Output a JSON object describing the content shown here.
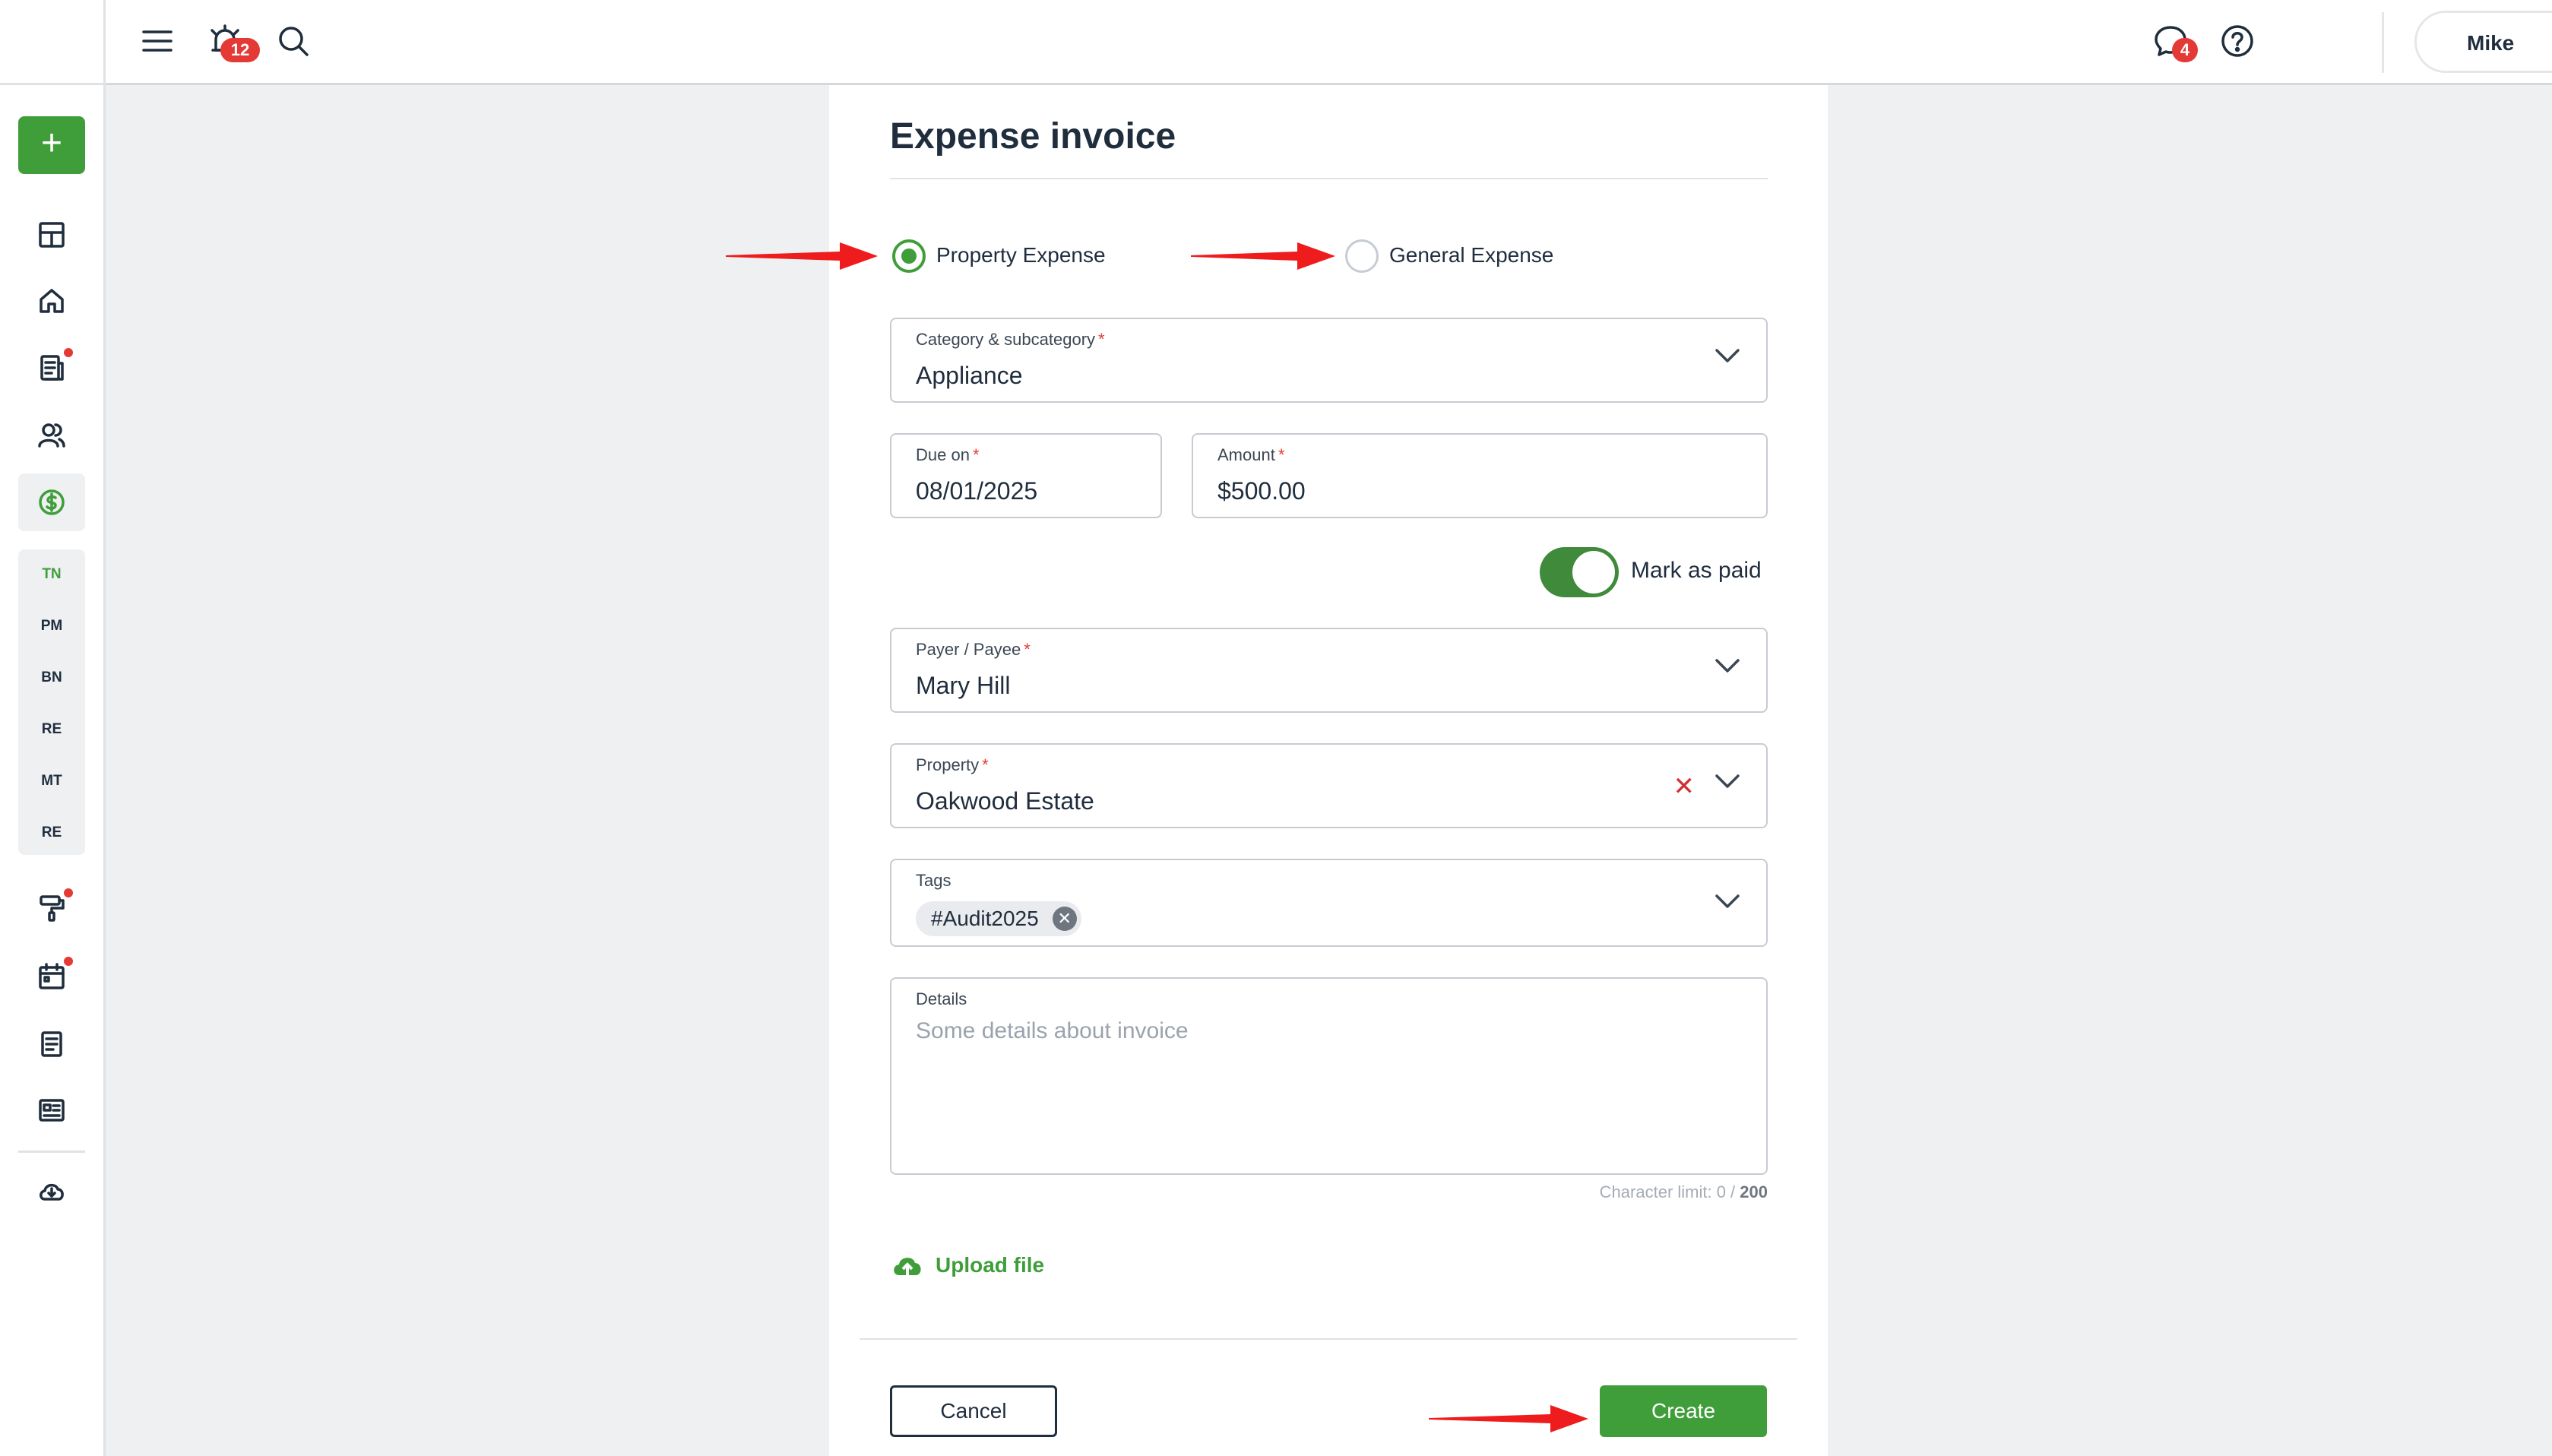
{
  "topbar": {
    "notifications_count": "12",
    "messages_count": "4",
    "user_name": "Mike"
  },
  "sidebar": {
    "add_label": "+",
    "sub_items": [
      "TN",
      "PM",
      "BN",
      "RE",
      "MT",
      "RE"
    ]
  },
  "form": {
    "title": "Expense invoice",
    "radio_property": "Property Expense",
    "radio_general": "General Expense",
    "selected_type": "Property Expense",
    "category_label": "Category & subcategory",
    "category_value": "Appliance",
    "due_label": "Due on",
    "due_value": "08/01/2025",
    "amount_label": "Amount",
    "amount_value": "$500.00",
    "mark_paid_label": "Mark as paid",
    "mark_paid_on": true,
    "payee_label": "Payer / Payee",
    "payee_value": "Mary Hill",
    "property_label": "Property",
    "property_value": "Oakwood Estate",
    "tags_label": "Tags",
    "tag_chip": "#Audit2025",
    "details_label": "Details",
    "details_placeholder": "Some details about invoice",
    "char_limit_prefix": "Character limit: 0 / ",
    "char_limit_max": "200",
    "upload_label": "Upload file",
    "cancel_label": "Cancel",
    "create_label": "Create",
    "required_mark": "*"
  },
  "colors": {
    "accent_green": "#3f9e3a",
    "annotation_red": "#ee1c1c",
    "badge_red": "#e53935"
  }
}
